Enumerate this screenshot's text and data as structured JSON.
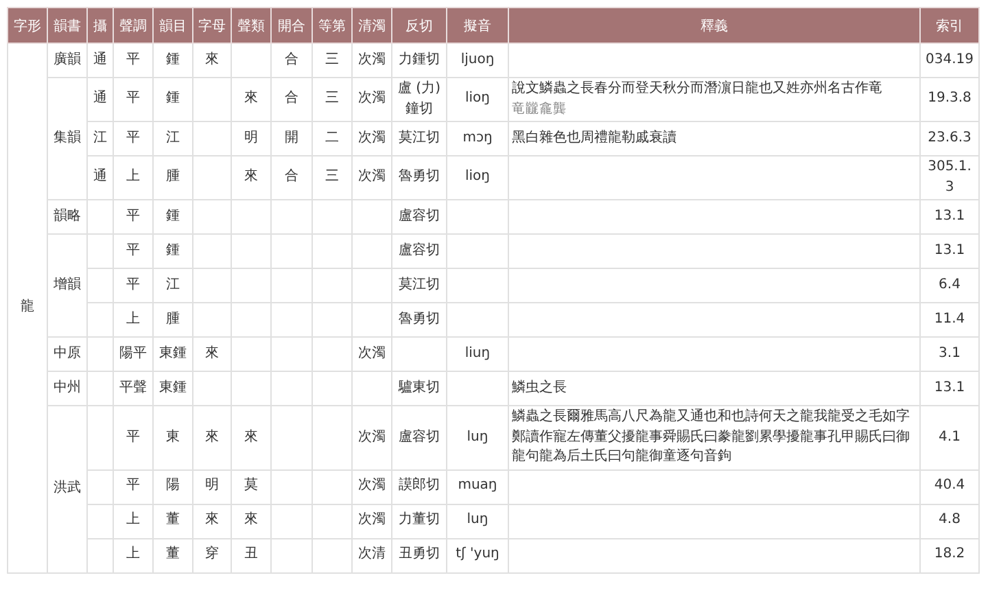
{
  "columns": [
    "字形",
    "韻書",
    "攝",
    "聲調",
    "韻目",
    "字母",
    "聲類",
    "開合",
    "等第",
    "清濁",
    "反切",
    "擬音",
    "釋義",
    "索引"
  ],
  "glyph": "龍",
  "groups": [
    {
      "book": "廣韻",
      "rows": [
        {
          "she": "通",
          "tone": "平",
          "rhyme": "鍾",
          "initial": "來",
          "kaihe": "合",
          "grade": "三",
          "voicing": "次濁",
          "fanqie": "力鍾切",
          "reconstruction": "ljuoŋ",
          "index": "034.19"
        }
      ]
    },
    {
      "book": "集韻",
      "rows": [
        {
          "she": "通",
          "tone": "平",
          "rhyme": "鍾",
          "initial_class": "來",
          "kaihe": "合",
          "grade": "三",
          "voicing": "次濁",
          "fanqie": "盧 (力) 鐘切",
          "reconstruction": "lioŋ",
          "gloss": "說文鱗蟲之長春分而登天秋分而潛濵日龍也又姓亦州名古作竜",
          "gloss_note": "竜龖龕龔",
          "index": "19.3.8"
        },
        {
          "she": "江",
          "tone": "平",
          "rhyme": "江",
          "initial_class": "明",
          "kaihe": "開",
          "grade": "二",
          "voicing": "次濁",
          "fanqie": "莫江切",
          "reconstruction": "mɔŋ",
          "gloss": "黑白雜色也周禮龍勒戚衰讀",
          "index": "23.6.3"
        },
        {
          "she": "通",
          "tone": "上",
          "rhyme": "腫",
          "initial_class": "來",
          "kaihe": "合",
          "grade": "三",
          "voicing": "次濁",
          "fanqie": "魯勇切",
          "reconstruction": "lioŋ",
          "index": "305.1.3"
        }
      ]
    },
    {
      "book": "韻略",
      "rows": [
        {
          "tone": "平",
          "rhyme": "鍾",
          "fanqie": "盧容切",
          "index": "13.1"
        }
      ]
    },
    {
      "book": "增韻",
      "rows": [
        {
          "tone": "平",
          "rhyme": "鍾",
          "fanqie": "盧容切",
          "index": "13.1"
        },
        {
          "tone": "平",
          "rhyme": "江",
          "fanqie": "莫江切",
          "index": "6.4"
        },
        {
          "tone": "上",
          "rhyme": "腫",
          "fanqie": "魯勇切",
          "index": "11.4"
        }
      ]
    },
    {
      "book": "中原",
      "rows": [
        {
          "tone": "陽平",
          "rhyme": "東鍾",
          "initial": "來",
          "voicing": "次濁",
          "reconstruction": "liuŋ",
          "index": "3.1"
        }
      ]
    },
    {
      "book": "中州",
      "rows": [
        {
          "tone": "平聲",
          "rhyme": "東鍾",
          "fanqie": "驢東切",
          "gloss": "鱗虫之長",
          "index": "13.1"
        }
      ]
    },
    {
      "book": "洪武",
      "rows": [
        {
          "tone": "平",
          "rhyme": "東",
          "initial": "來",
          "initial_class": "來",
          "voicing": "次濁",
          "fanqie": "盧容切",
          "reconstruction": "luŋ",
          "gloss": "鱗蟲之長爾雅馬高八尺為龍又通也和也詩何天之龍我龍受之毛如字鄭讀作寵左傳董父擾龍事舜賜氏曰豢龍劉累學擾龍事孔甲賜氏曰御龍句龍為后土氏曰句龍御童逐句音鉤",
          "index": "4.1"
        },
        {
          "tone": "平",
          "rhyme": "陽",
          "initial": "明",
          "initial_class": "莫",
          "voicing": "次濁",
          "fanqie": "謨郎切",
          "reconstruction": "muaŋ",
          "index": "40.4"
        },
        {
          "tone": "上",
          "rhyme": "董",
          "initial": "來",
          "initial_class": "來",
          "voicing": "次濁",
          "fanqie": "力董切",
          "reconstruction": "luŋ",
          "index": "4.8"
        },
        {
          "tone": "上",
          "rhyme": "董",
          "initial": "穿",
          "initial_class": "丑",
          "voicing": "次清",
          "fanqie": "丑勇切",
          "reconstruction": "tʃ 'yuŋ",
          "index": "18.2"
        }
      ]
    }
  ]
}
